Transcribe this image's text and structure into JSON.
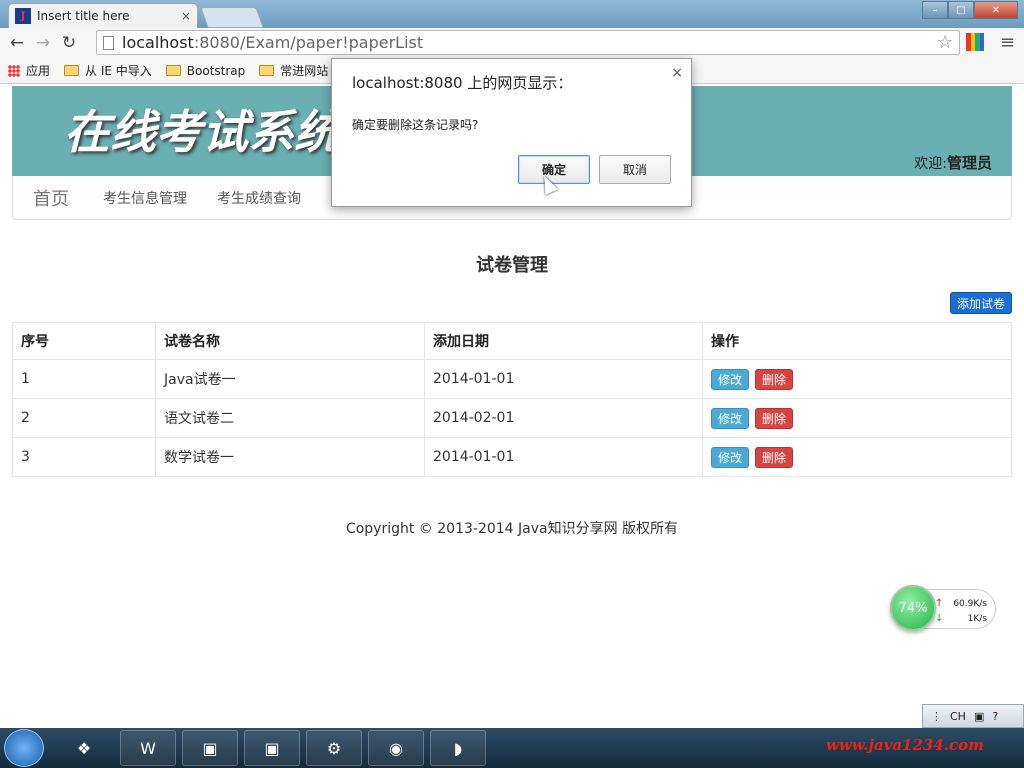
{
  "browser": {
    "tab_title": "Insert title here",
    "tab_close": "×",
    "url_host": "localhost",
    "url_rest": ":8080/Exam/paper!paperList",
    "bookmarks": [
      "应用",
      "从 IE 中导入",
      "Bootstrap",
      "常进网站"
    ],
    "win_min": "–",
    "win_max": "□",
    "win_close": "✕"
  },
  "header": {
    "logo": "在线考试系统",
    "welcome_prefix": "欢迎:",
    "welcome_user": "管理员"
  },
  "nav": {
    "home": "首页",
    "items": [
      "考生信息管理",
      "考生成绩查询"
    ]
  },
  "page": {
    "title": "试卷管理",
    "add_button": "添加试卷"
  },
  "table": {
    "headers": [
      "序号",
      "试卷名称",
      "添加日期",
      "操作"
    ],
    "rows": [
      {
        "id": "1",
        "name": "Java试卷一",
        "date": "2014-01-01"
      },
      {
        "id": "2",
        "name": "语文试卷二",
        "date": "2014-02-01"
      },
      {
        "id": "3",
        "name": "数学试卷一",
        "date": "2014-01-01"
      }
    ],
    "edit_label": "修改",
    "delete_label": "删除"
  },
  "footer": "Copyright © 2013-2014 Java知识分享网 版权所有",
  "dialog": {
    "title": "localhost:8080 上的网页显示：",
    "message": "确定要删除这条记录吗?",
    "ok": "确定",
    "cancel": "取消",
    "close": "×"
  },
  "net_widget": {
    "percent": "74%",
    "up": "60.9K/s",
    "down": "1K/s"
  },
  "ime": {
    "lang": "CH"
  },
  "taskbar": {
    "brand": "www.java1234.com"
  },
  "colors": {
    "header_bg": "#6aafb1",
    "primary_button": "#1b6fd1",
    "edit_button": "#4aa9d6",
    "delete_button": "#d8443f"
  }
}
